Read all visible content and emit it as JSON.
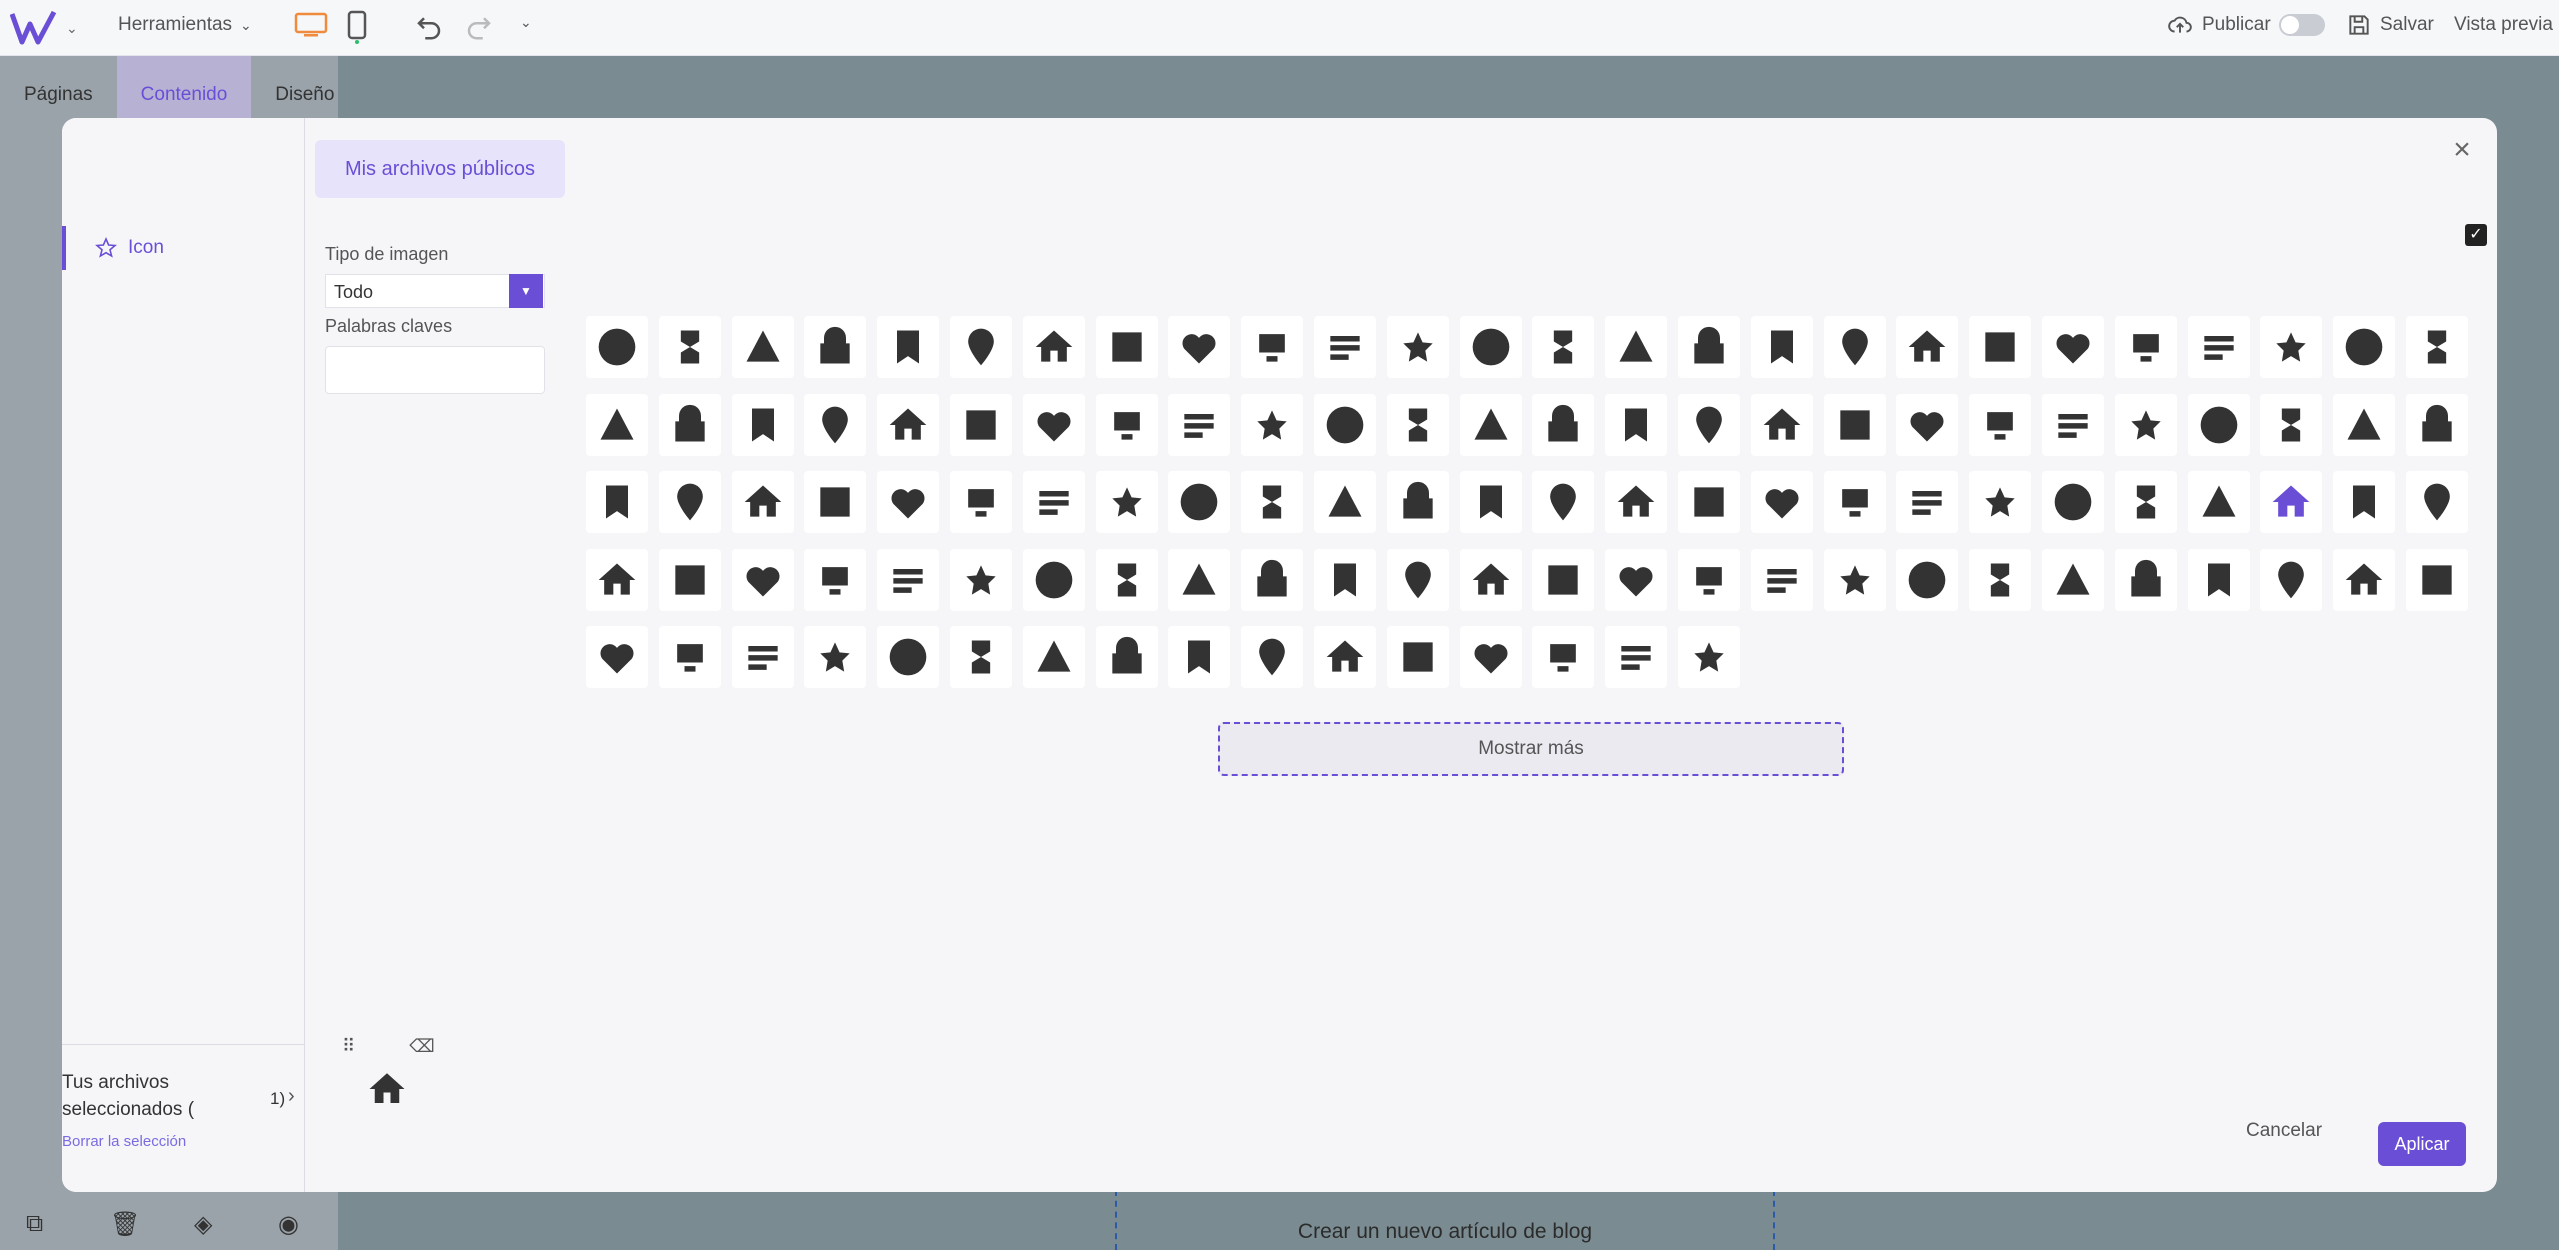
{
  "topbar": {
    "tools_label": "Herramientas",
    "publish_label": "Publicar",
    "save_label": "Salvar",
    "preview_label": "Vista previa"
  },
  "left_panel": {
    "tabs": [
      "Páginas",
      "Contenido",
      "Diseño"
    ],
    "active_tab": "Contenido"
  },
  "canvas": {
    "new_blog_label": "Crear un nuevo artículo de blog"
  },
  "modal": {
    "public_files_tab": "Mis archivos públicos",
    "category": "Icon",
    "filter": {
      "image_type_label": "Tipo de imagen",
      "image_type_value": "Todo",
      "keywords_label": "Palabras claves"
    },
    "selected": {
      "title": "Tus archivos seleccionados (",
      "count": "1)",
      "clear_label": "Borrar la selección"
    },
    "show_more_label": "Mostrar más",
    "cancel_label": "Cancelar",
    "apply_label": "Aplicar",
    "icons": [
      "3d-rotation-icon",
      "accessibility-icon",
      "accessible-icon",
      "account-balance-icon",
      "account-balance-wallet-icon",
      "account-box-icon",
      "account-circle-icon",
      "add-shopping-cart-icon",
      "alarm-icon",
      "alarm-add-icon",
      "alarm-off-icon",
      "alarm-on-icon",
      "all-out-icon",
      "announcement-icon",
      "aspect-ratio-icon",
      "assessment-icon",
      "assignment-icon",
      "assignment-ind-icon",
      "assignment-late-icon",
      "assignment-return-icon",
      "assignment-returned-icon",
      "assignment-turned-in-icon",
      "autorenew-icon",
      "backup-icon",
      "book-icon",
      "bookmark-icon",
      "bookmark-border-icon",
      "bug-report-icon",
      "build-icon",
      "cached-icon",
      "card-giftcard-icon",
      "card-membership-icon",
      "card-travel-icon",
      "change-history-icon",
      "check-circle-icon",
      "chrome-reader-mode-icon",
      "class-icon",
      "code-icon",
      "compare-arrows-icon",
      "copyright-icon",
      "credit-card-icon",
      "dashboard-icon",
      "date-range-icon",
      "delete-icon",
      "delete-forever-icon",
      "description-icon",
      "dns-icon",
      "done-icon",
      "done-all-icon",
      "donut-large-icon",
      "donut-small-icon",
      "euro-symbol-icon",
      "event-icon",
      "event-seat-icon",
      "exit-to-app-icon",
      "explore-icon",
      "extension-icon",
      "face-icon",
      "favorite-icon",
      "favorite-border-icon",
      "find-in-page-icon",
      "find-replace-icon",
      "fingerprint-icon",
      "flight-land-icon",
      "flight-takeoff-icon",
      "flip-to-back-icon",
      "flip-to-front-icon",
      "g-translate-icon",
      "gavel-icon",
      "get-app-icon",
      "grade-icon",
      "group-work-icon",
      "help-icon",
      "highlight-off-icon",
      "history-icon",
      "home-icon",
      "hourglass-empty-icon",
      "hourglass-full-icon",
      "https-icon",
      "important-devices-icon",
      "info-icon",
      "info-outline-icon",
      "input-icon",
      "invert-colors-icon",
      "label-icon",
      "label-outline-icon",
      "language-icon",
      "launch-icon",
      "lightbulb-outline-icon",
      "lock-icon",
      "lock-open-icon",
      "lock-outline-icon",
      "loyalty-icon",
      "markunread-mailbox-icon",
      "motorcycle-icon",
      "note-add-icon",
      "opacity-icon",
      "open-in-browser-icon",
      "open-in-new-icon",
      "open-with-icon",
      "pageview-icon",
      "pan-tool-icon",
      "perm-camera-mic-icon",
      "perm-contact-calendar-icon",
      "perm-data-setting-icon",
      "perm-device-information-icon",
      "perm-identity-icon",
      "perm-media-icon",
      "perm-phone-msg-icon",
      "perm-scan-wifi-icon",
      "pets-icon",
      "picture-in-picture-icon",
      "picture-in-picture-alt-icon",
      "play-for-work-icon",
      "power-settings-icon",
      "pregnant-woman-icon",
      "print-icon",
      "query-builder-icon",
      "question-answer-icon",
      "receipt-icon"
    ],
    "selected_icon": "home-icon",
    "accent_color": "#6a4fd6"
  }
}
